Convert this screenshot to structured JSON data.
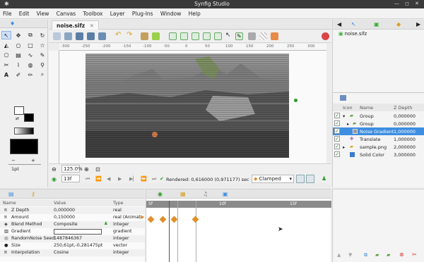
{
  "window": {
    "title": "Synfig Studio",
    "controls": "— ◻ ✕"
  },
  "menu": [
    "File",
    "Edit",
    "View",
    "Canvas",
    "Toolbox",
    "Layer",
    "Plug-Ins",
    "Window",
    "Help"
  ],
  "document": {
    "tab_label": "noise.sifz"
  },
  "ruler": {
    "ticks": [
      "-300",
      "-250",
      "-200",
      "-150",
      "-100",
      "-50",
      "0",
      "50",
      "100",
      "150",
      "200",
      "250",
      "300"
    ]
  },
  "canvas_status": {
    "zoom": "125.0%",
    "frame": "13f",
    "rendered_text": "Rendered: 0,616000 (0,971177) sec",
    "interpolation": "Clamped"
  },
  "toolbox": {
    "brush_size": "1pt"
  },
  "layers_panel": {
    "root": "noise.sifz",
    "columns": [
      "Icon",
      "Name",
      "Z Depth"
    ],
    "rows": [
      {
        "name": "Group",
        "z": "0,000000",
        "icon": "folder-icon",
        "indent": 0,
        "expanded": true,
        "selected": false
      },
      {
        "name": "Group",
        "z": "0,000000",
        "icon": "folder-icon",
        "indent": 1,
        "expanded": false,
        "selected": false
      },
      {
        "name": "Noise Gradient",
        "z": "1,000000",
        "icon": "gradient-icon",
        "indent": 1,
        "expanded": false,
        "selected": true
      },
      {
        "name": "Translate",
        "z": "1,000000",
        "icon": "translate-icon",
        "indent": 0,
        "expanded": false,
        "selected": false
      },
      {
        "name": "sample.png",
        "z": "2,000000",
        "icon": "folder-icon",
        "indent": 0,
        "expanded": false,
        "selected": false
      },
      {
        "name": "Solid Color",
        "z": "3,000000",
        "icon": "solid-color-icon",
        "indent": 0,
        "expanded": false,
        "selected": false
      }
    ]
  },
  "params_panel": {
    "columns": [
      "Name",
      "Value",
      "Type"
    ],
    "rows": [
      {
        "symbol": "π",
        "name": "Z Depth",
        "value": "0,000000",
        "type": "real"
      },
      {
        "symbol": "π",
        "name": "Amount",
        "value": "0,150000",
        "type": "real (Animate"
      },
      {
        "symbol": "◈",
        "name": "Blend Method",
        "value": "Composite",
        "type": "integer"
      },
      {
        "symbol": "▥",
        "name": "Gradient",
        "value": "",
        "type": "gradient"
      },
      {
        "symbol": "◎",
        "name": "RandomNoise Seed",
        "value": "1487846367",
        "type": "integer"
      },
      {
        "symbol": "●",
        "name": "Size",
        "value": "250,61pt,-0,281475pt",
        "type": "vector"
      },
      {
        "symbol": "π",
        "name": "Interpolation",
        "value": "Cosine",
        "type": "integer"
      }
    ]
  },
  "timetrack": {
    "marks": [
      "5f",
      "10f",
      "15f"
    ]
  },
  "colors": {
    "accent": "#3d8ee0",
    "selected_row": "#3d8ee0",
    "keyframe": "#e0902a"
  }
}
